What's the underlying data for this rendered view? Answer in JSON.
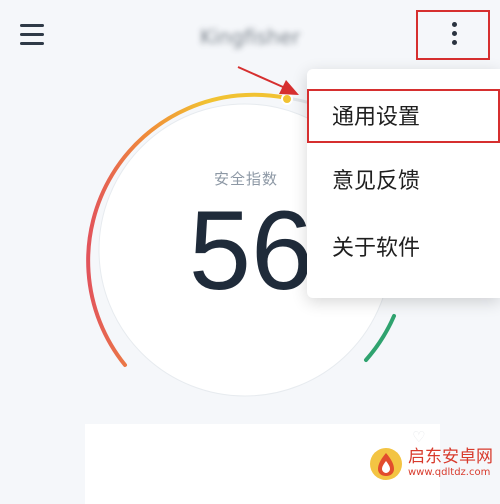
{
  "app": {
    "title": "Kingfisher"
  },
  "header": {
    "menu_icon": "hamburger-menu-icon",
    "more_icon": "vertical-dots-icon"
  },
  "gauge": {
    "label": "安全指数",
    "score": "56"
  },
  "menu": {
    "items": [
      {
        "label": "通用设置"
      },
      {
        "label": "意见反馈"
      },
      {
        "label": "关于软件"
      }
    ]
  },
  "watermark": {
    "text": "启东安卓网",
    "url": "www.qdltdz.com"
  },
  "colors": {
    "highlight": "#d62f2f",
    "gauge_red": "#e2545b",
    "gauge_orange": "#f08d39",
    "gauge_yellow": "#f1c232",
    "gauge_green": "#2fa36f",
    "text_dark": "#1f2b3a"
  }
}
